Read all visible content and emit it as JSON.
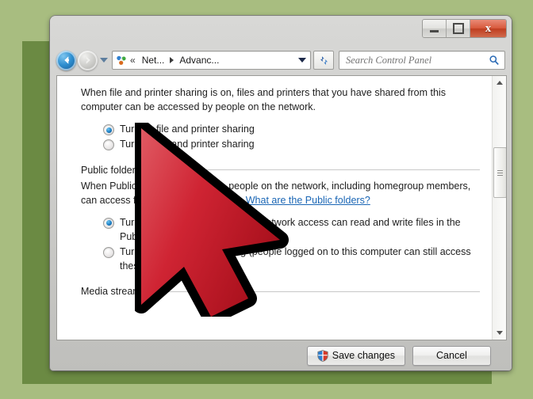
{
  "desktop": {
    "background_color": "#a8bd80",
    "panel_color": "#6b8a43"
  },
  "window": {
    "controls": {
      "minimize_label": "–",
      "maximize_label": "□",
      "close_label": "x"
    },
    "navigation": {
      "back_icon": "back-arrow-icon",
      "forward_icon": "forward-arrow-icon",
      "recent_pages_icon": "chevron-down-icon",
      "location_icon": "network-icon",
      "overflow_label": "«",
      "breadcrumbs": [
        {
          "label": "Net..."
        },
        {
          "label": "Advanc..."
        }
      ],
      "breadcrumb_dropdown_icon": "chevron-down-icon",
      "refresh_icon": "refresh-icon"
    },
    "search": {
      "placeholder": "Search Control Panel",
      "value": "",
      "icon": "search-icon"
    }
  },
  "content": {
    "file_printer_sharing": {
      "description": "When file and printer sharing is on, files and printers that you have shared from this computer can be accessed by people on the network.",
      "options": [
        {
          "label": "Turn on file and printer sharing",
          "selected": true
        },
        {
          "label": "Turn off file and printer sharing",
          "selected": false
        }
      ]
    },
    "public_folder_sharing": {
      "heading": "Public folder sharing",
      "description_part1": "When Public folder sharing is on, people on the network, including homegroup members, can access files in the Public folders. ",
      "link_text": "What are the Public folders?",
      "options": [
        {
          "label": "Turn on sharing so anyone with network access can read and write files in the Public folders",
          "selected": true
        },
        {
          "label": "Turn off Public folder sharing (people logged on to this computer can still access these folders)",
          "selected": false
        }
      ]
    },
    "media_streaming": {
      "heading": "Media streaming"
    },
    "scrollbar": {
      "up_icon": "scroll-up-arrow-icon",
      "down_icon": "scroll-down-arrow-icon"
    }
  },
  "footer": {
    "save_label": "Save changes",
    "save_icon": "uac-shield-icon",
    "cancel_label": "Cancel"
  },
  "cursor": {
    "name": "arrow-cursor",
    "fill_color": "#c8202e",
    "outline_color": "#000000"
  }
}
